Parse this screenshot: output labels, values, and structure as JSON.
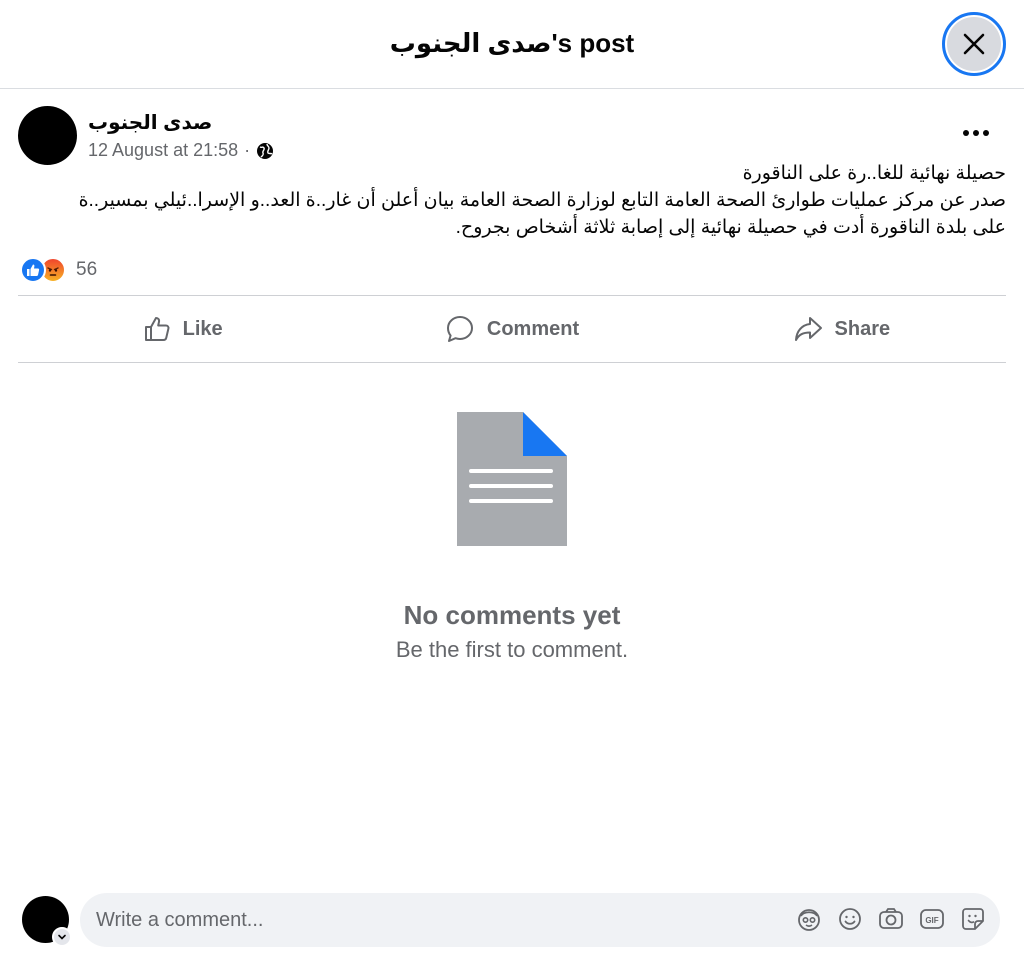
{
  "header": {
    "title": "صدى الجنوب's post"
  },
  "post": {
    "author": "صدى الجنوب",
    "timestamp": "12 August at 21:58",
    "separator": "·",
    "privacy_icon": "globe-icon",
    "text_lines": [
      "حصيلة نهائية للغا..رة على الناقورة",
      "صدر عن مركز عمليات طوارئ الصحة العامة التابع لوزارة الصحة العامة بيان أعلن أن غار..ة العد..و الإسرا..ئيلي بمسير..ة",
      "على بلدة الناقورة أدت في حصيلة نهائية إلى إصابة ثلاثة أشخاص بجروح."
    ],
    "reactions": {
      "icons": [
        "like-icon",
        "angry-icon"
      ],
      "count": "56"
    }
  },
  "actions": {
    "like_label": "Like",
    "comment_label": "Comment",
    "share_label": "Share"
  },
  "empty_state": {
    "title": "No comments yet",
    "subtitle": "Be the first to comment."
  },
  "composer": {
    "placeholder": "Write a comment...",
    "tools": [
      "avatar-sticker-icon",
      "emoji-icon",
      "camera-icon",
      "gif-icon",
      "sticker-icon"
    ]
  },
  "colors": {
    "accent": "#1877f2",
    "secondary_text": "#65676b",
    "divider": "#ced0d4",
    "input_bg": "#f0f2f5"
  }
}
